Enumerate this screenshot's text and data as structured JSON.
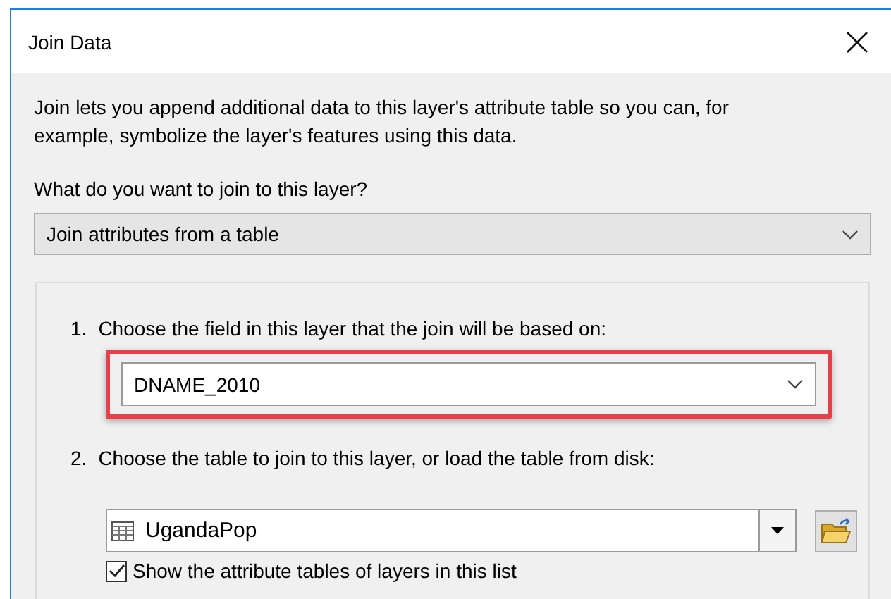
{
  "window": {
    "title": "Join Data"
  },
  "intro": "Join lets you append additional data to this layer's attribute table so you can, for example, symbolize the layer's features using this data.",
  "question": "What do you want to join to this layer?",
  "join_type": {
    "value": "Join attributes from a table"
  },
  "steps": [
    {
      "number": "1.",
      "label": "Choose the field in this layer that the join will be based on:",
      "kind": "field",
      "value": "DNAME_2010",
      "highlighted": true
    },
    {
      "number": "2.",
      "label": "Choose the table to join to this layer, or load the table from disk:",
      "kind": "table",
      "value": "UgandaPop",
      "highlighted": false
    }
  ],
  "show_layer_tables": {
    "label": "Show the attribute tables of layers in this list",
    "checked": true
  }
}
